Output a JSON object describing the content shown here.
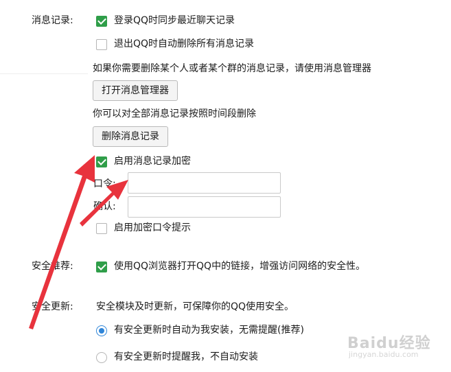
{
  "history": {
    "section_label": "消息记录:",
    "sync_recent": {
      "label": "登录QQ时同步最近聊天记录",
      "checked": true
    },
    "delete_on_exit": {
      "label": "退出QQ时自动删除所有消息记录",
      "checked": false
    },
    "manager_hint": "如果你需要删除某个人或者某个群的消息记录，请使用消息管理器",
    "open_manager_button": "打开消息管理器",
    "delete_hint": "你可以对全部消息记录按照时间段删除",
    "delete_button": "删除消息记录",
    "encrypt": {
      "label": "启用消息记录加密",
      "checked": true
    },
    "password_label": "口令:",
    "password_value": "",
    "confirm_label": "确认:",
    "confirm_value": "",
    "password_hint": {
      "label": "启用加密口令提示",
      "checked": false
    }
  },
  "security_recommend": {
    "section_label": "安全推荐:",
    "browser_links": {
      "label": "使用QQ浏览器打开QQ中的链接，增强访问网络的安全性。",
      "checked": true
    }
  },
  "security_update": {
    "section_label": "安全更新:",
    "description": "安全模块及时更新，可保障你的QQ使用安全。",
    "options": [
      {
        "label": "有安全更新时自动为我安装，无需提醒(推荐)",
        "selected": true
      },
      {
        "label": "有安全更新时提醒我，不自动安装",
        "selected": false
      }
    ]
  },
  "watermark": {
    "logo": "Baidu经验",
    "url": "jingyan.baidu.com"
  },
  "colors": {
    "checkbox_checked": "#2f9e49",
    "radio_selected": "#2f85d8",
    "annotation_arrow": "#e8333d"
  }
}
